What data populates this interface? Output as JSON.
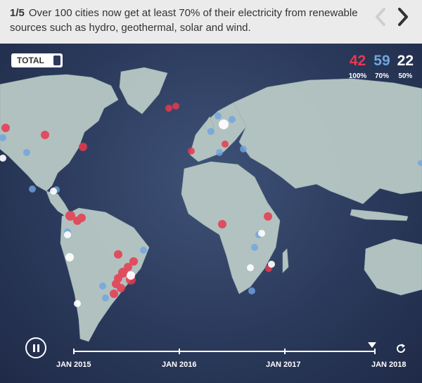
{
  "header": {
    "step": "1/5",
    "caption": "Over 100 cities now get at least 70% of their electricity from renewable sources such as hydro, geothermal, solar and wind.",
    "prev_icon": "chevron-left-icon",
    "next_icon": "chevron-right-icon"
  },
  "toolbar": {
    "total_label": "TOTAL"
  },
  "counters": [
    {
      "value": "42",
      "label": "100%",
      "color": "#e8394f"
    },
    {
      "value": "59",
      "label": "70%",
      "color": "#6fa5e0"
    },
    {
      "value": "22",
      "label": "50%",
      "color": "#ffffff"
    }
  ],
  "timeline": {
    "labels": [
      "JAN 2015",
      "JAN 2016",
      "JAN 2017",
      "JAN 2018"
    ],
    "play_icon": "pause-icon",
    "replay_icon": "replay-icon"
  },
  "colors": {
    "header_bg": "#ebebeb",
    "ocean": "#2b3a5c",
    "land": "#b8c9c6",
    "city_100": "#e8394f",
    "city_70": "#6fa5e0",
    "city_50": "#ffffff"
  }
}
